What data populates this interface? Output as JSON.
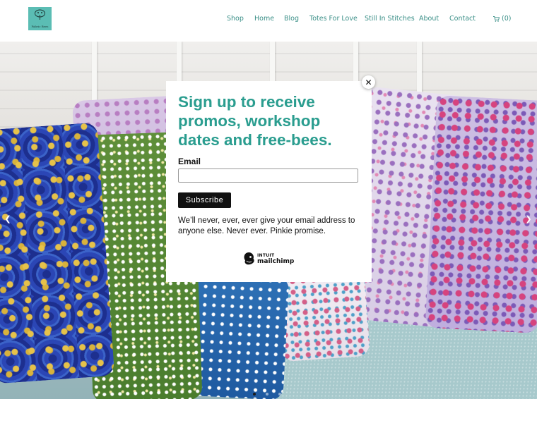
{
  "header": {
    "logo_text": "Fabric Bees",
    "nav": [
      "Shop",
      "Home",
      "Blog",
      "Totes For Love",
      "Still In Stitches",
      "About",
      "Contact"
    ],
    "cart_label": "(0)",
    "link_color": "#3a8f87"
  },
  "hero": {
    "slides": 3,
    "active_slide": 1,
    "prev_icon": "chevron-left-icon",
    "next_icon": "chevron-right-icon"
  },
  "modal": {
    "title": "Sign up to receive promos, workshop dates and free-bees.",
    "email_label": "Email",
    "email_value": "",
    "subscribe_label": "Subscribe",
    "note": "We’ll never, ever, ever give your email address to anyone else. Never ever. Pinkie promise.",
    "brand_small": "INTUIT",
    "brand_big": "mailchimp",
    "title_color": "#2a9d8f",
    "close_icon": "close-icon"
  }
}
